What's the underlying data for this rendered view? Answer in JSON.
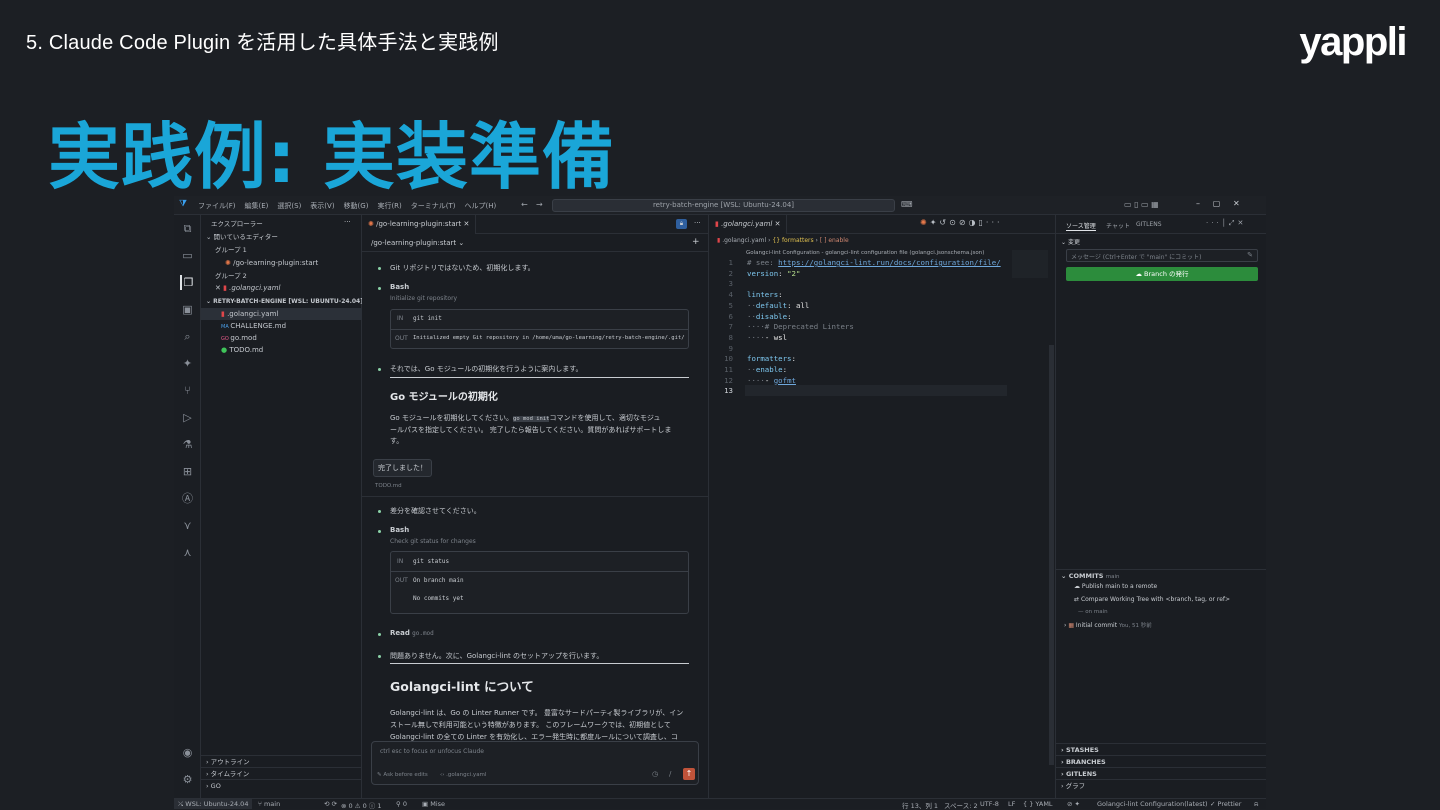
{
  "slide": {
    "section": "5. Claude Code Plugin を活用した具体手法と実践例",
    "title": "実践例: 実装準備",
    "logo": "yappli"
  },
  "window": {
    "menu": [
      "ファイル(F)",
      "編集(E)",
      "選択(S)",
      "表示(V)",
      "移動(G)",
      "実行(R)",
      "ターミナル(T)",
      "ヘルプ(H)"
    ],
    "search": "retry-batch-engine [WSL: Ubuntu-24.04]"
  },
  "sidebar": {
    "title": "エクスプローラー",
    "open_editors": "開いているエディター",
    "group1": "グループ 1",
    "group1_file": "/go-learning-plugin:start",
    "group2": "グループ 2",
    "group2_file": ".golangci.yaml",
    "workspace": "RETRY-BATCH-ENGINE [WSL: UBUNTU-24.04]",
    "files": [
      ".golangci.yaml",
      "CHALLENGE.md",
      "go.mod",
      "TODO.md"
    ],
    "outline": "アウトライン",
    "timeline": "タイムライン",
    "go": "GO"
  },
  "chat": {
    "tab": "/go-learning-plugin:start",
    "header": "/go-learning-plugin:start",
    "msg1": "Git リポジトリではないため、初期化します。",
    "bash1": "Bash",
    "bash1_desc": "Initialize git repository",
    "in_label": "IN",
    "out_label": "OUT",
    "cmd1": "git init",
    "out1": "Initialized empty Git repository in /home/uma/go-learning/retry-batch-engine/.git/",
    "msg2": "それでは、Go モジュールの初期化を行うように案内します。",
    "h_gomod": "Go モジュールの初期化",
    "p_gomod_a": "Go モジュールを初期化してください。",
    "p_gomod_code": "go mod init",
    "p_gomod_b": "コマンドを使用して、適切なモジュ",
    "p_gomod_c": "ールパスを指定してください。 完了したら報告してください。質問があればサポートしま",
    "p_gomod_d": "す。",
    "user_reply": "完了しました！",
    "todo": "TODO.md",
    "msg3": "差分を確認させてください。",
    "bash2": "Bash",
    "bash2_desc": "Check git status for changes",
    "cmd2": "git status",
    "out2a": "On branch main",
    "out2b": "No commits yet",
    "read": "Read",
    "read_file": "go.mod",
    "msg4": "問題ありません。次に、Golangci-lint のセットアップを行います。",
    "h_lint": "Golangci-lint について",
    "p_lint_a": "Golangci-lint は、Go の Linter Runner です。 豊富なサードパーティ製ライブラリが、イン",
    "p_lint_b": "ストール無しで利用可能という特徴があります。 このフレームワークでは、初期値として",
    "p_lint_c": "Golangci-lint の全ての Linter を有効化し、エラー発生時に都度ルールについて調査し、コ",
    "input_placeholder": "ctrl esc to focus or unfocus Claude",
    "ask": "Ask before edits",
    "input_file": ".golangci.yaml"
  },
  "editor": {
    "tab": ".golangci.yaml",
    "breadcrumb": [
      ".golangci.yaml",
      "{} formatters",
      "[ ] enable"
    ],
    "schema": "Golangci-lint Configuration - golangci-lint configuration file (golangci.jsonschema.json)",
    "lines": [
      "# see: https://golangci-lint.run/docs/configuration/file/",
      "version: \"2\"",
      "",
      "linters:",
      "  default: all",
      "  disable:",
      "    # Deprecated Linters",
      "    - wsl",
      "",
      "formatters:",
      "  enable:",
      "    - gofmt",
      ""
    ]
  },
  "scm": {
    "tabs": [
      "ソース管理",
      "チャット",
      "GITLENS"
    ],
    "changes": "変更",
    "message_placeholder": "メッセージ (Ctrl+Enter で \"main\" にコミット)",
    "publish": "Branch の発行",
    "commits": "COMMITS",
    "commits_branch": "main",
    "publish_main": "Publish main to a remote",
    "compare": "Compare Working Tree with <branch, tag, or ref>",
    "on_main": "on main",
    "initial": "Initial commit",
    "initial_meta": "You, 51 秒前",
    "stashes": "STASHES",
    "branches": "BRANCHES",
    "gitlens": "GITLENS",
    "graph": "グラフ"
  },
  "status": {
    "remote": "WSL: Ubuntu-24.04",
    "branch": "main",
    "problems": "⊗ 0 ⚠ 0 ⓘ 1",
    "ports": "0",
    "mise": "Mise",
    "position": "行 13、列 1",
    "spaces": "スペース: 2",
    "encoding": "UTF-8",
    "eol": "LF",
    "lang": "YAML",
    "schema": "Golangci-lint Configuration(latest)",
    "prettier": "Prettier"
  }
}
